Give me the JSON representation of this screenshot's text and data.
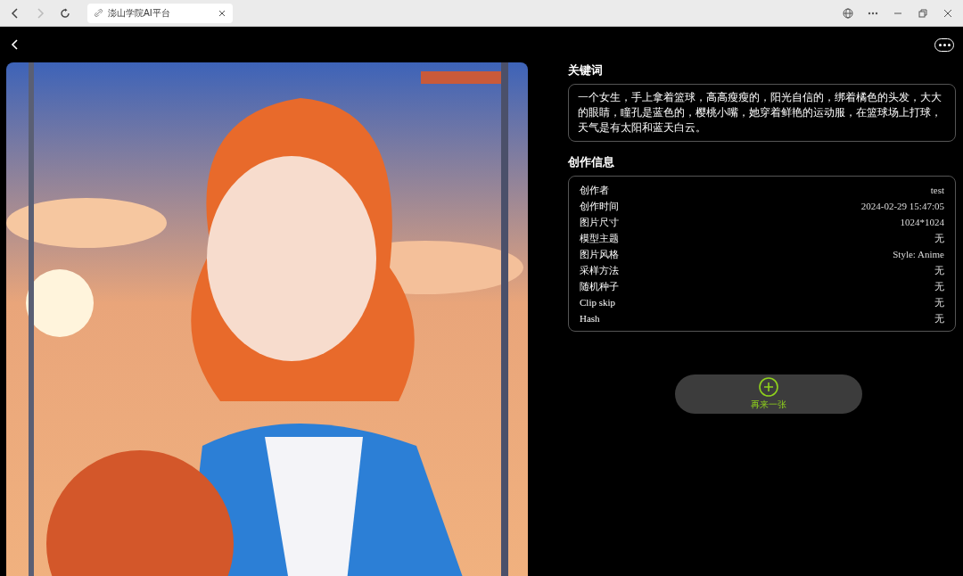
{
  "browser": {
    "tab_title": "澎山学院AI平台"
  },
  "keywords": {
    "heading": "关键词",
    "text": "一个女生，手上拿着篮球，高高瘦瘦的，阳光自信的，绑着橘色的头发，大大的眼睛，瞳孔是蓝色的，樱桃小嘴，她穿着鲜艳的运动服，在篮球场上打球，天气是有太阳和蓝天白云。"
  },
  "creation_info": {
    "heading": "创作信息",
    "rows": [
      {
        "label": "创作者",
        "value": "test"
      },
      {
        "label": "创作时间",
        "value": "2024-02-29 15:47:05"
      },
      {
        "label": "图片尺寸",
        "value": "1024*1024"
      },
      {
        "label": "模型主题",
        "value": "无"
      },
      {
        "label": "图片风格",
        "value": "Style: Anime"
      },
      {
        "label": "采样方法",
        "value": "无"
      },
      {
        "label": "随机种子",
        "value": "无"
      },
      {
        "label": "Clip skip",
        "value": "无"
      },
      {
        "label": "Hash",
        "value": "无"
      }
    ]
  },
  "regenerate_button": {
    "label": "再来一张"
  }
}
